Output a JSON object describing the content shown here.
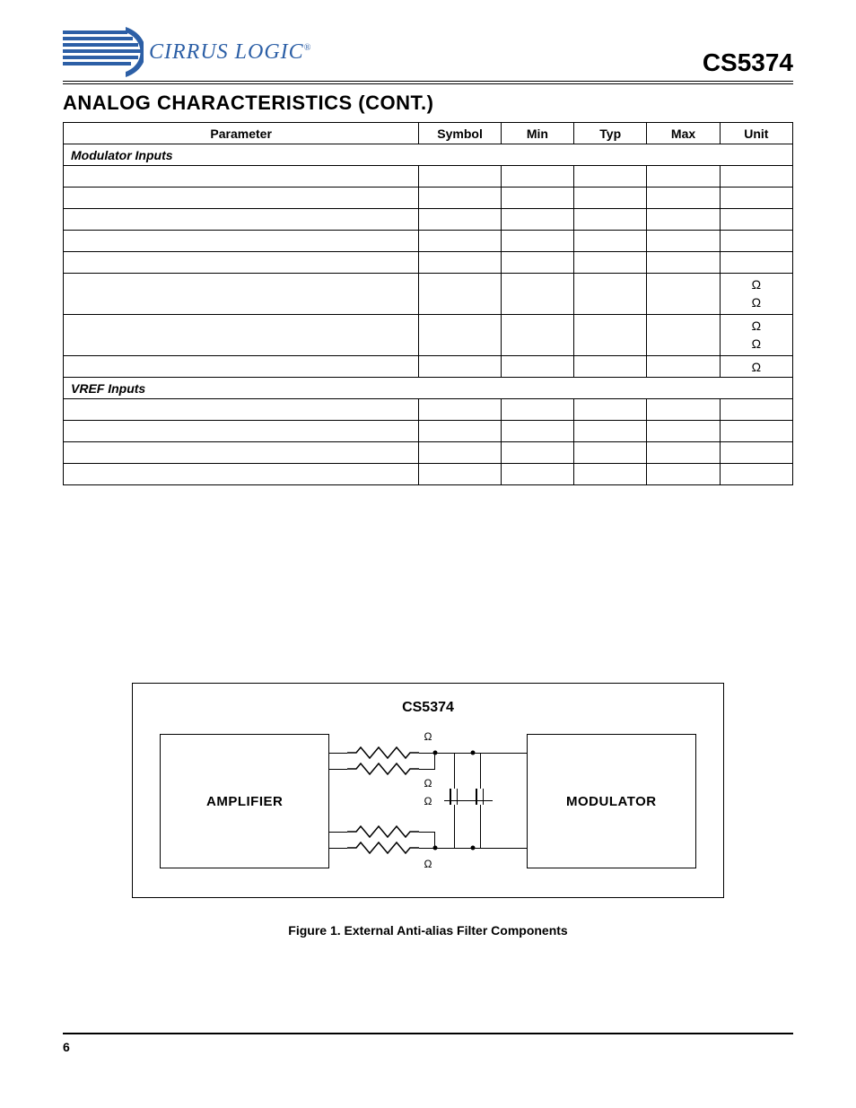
{
  "header": {
    "brand": "CIRRUS LOGIC",
    "brand_reg": "®",
    "part_number": "CS5374"
  },
  "section_title": "ANALOG CHARACTERISTICS (CONT.)",
  "table": {
    "headers": {
      "parameter": "Parameter",
      "symbol": "Symbol",
      "min": "Min",
      "typ": "Typ",
      "max": "Max",
      "unit": "Unit"
    },
    "sections": [
      {
        "title": "Modulator Inputs",
        "rows": [
          {
            "unit": ""
          },
          {
            "unit": ""
          },
          {
            "unit": ""
          },
          {
            "unit": ""
          },
          {
            "unit": ""
          },
          {
            "unit": "Ω\nΩ"
          },
          {
            "unit": "Ω\nΩ"
          },
          {
            "unit": "Ω"
          }
        ]
      },
      {
        "title": "VREF Inputs",
        "rows": [
          {
            "unit": ""
          },
          {
            "unit": ""
          },
          {
            "unit": ""
          },
          {
            "unit": ""
          }
        ]
      }
    ]
  },
  "figure": {
    "chip_label": "CS5374",
    "block_left": "AMPLIFIER",
    "block_right": "MODULATOR",
    "ohm": "Ω",
    "caption": "Figure 1.  External Anti-alias Filter Components"
  },
  "footer": {
    "page": "6"
  }
}
